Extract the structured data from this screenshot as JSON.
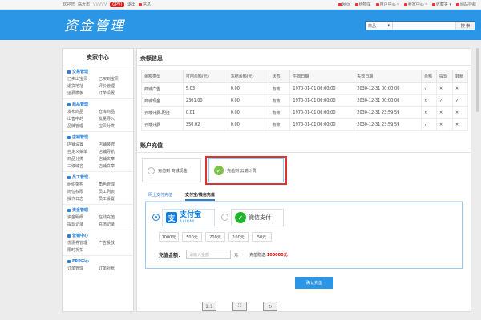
{
  "topbar": {
    "greeting": "欢迎您",
    "user": "临沂市",
    "stars": "VVVVV",
    "level": "GPVI",
    "logout": "退出",
    "messages": "信息",
    "links": [
      "网页",
      "购物车",
      "用户中心",
      "卖家中心",
      "收藏夹",
      "网站导航"
    ]
  },
  "header": {
    "logo": "资金管理",
    "search_category": "商品",
    "search_placeholder": "",
    "search_button": "搜 索"
  },
  "sidebar": {
    "title": "卖家中心",
    "sections": [
      {
        "heading": "交易管理",
        "items": [
          "已卖出宝贝",
          "已买到宝贝",
          "退货地址",
          "评价管理",
          "运费模板",
          "订单设置"
        ]
      },
      {
        "heading": "商品管理",
        "items": [
          "发布商品",
          "仓库商品",
          "出售中的",
          "批量导入",
          "品牌管理",
          "宝贝分类"
        ]
      },
      {
        "heading": "店铺管理",
        "items": [
          "店铺设置",
          "店铺装修",
          "自定义菜单",
          "店铺导航",
          "商品分类",
          "店铺文章",
          "二级域名",
          "店铺文章"
        ]
      },
      {
        "heading": "员工管理",
        "items": [
          "组织架构",
          "角色管理",
          "岗位权限",
          "员工列表",
          "操作日志",
          "员工设置"
        ]
      },
      {
        "heading": "资金管理",
        "items": [
          "资金明细",
          "在线充值",
          "提现记录",
          "充值记录"
        ]
      },
      {
        "heading": "营销中心",
        "items": [
          "优惠券管理",
          "广告投放",
          "限时折扣"
        ]
      },
      {
        "heading": "ERP中心",
        "items": [
          "订单管理",
          "订单对账"
        ]
      }
    ]
  },
  "balance": {
    "title": "余额信息",
    "columns": [
      "余额类型",
      "可用余额(元)",
      "冻结余额(元)",
      "状态",
      "生效日期",
      "失效日期",
      "余额",
      "提现",
      "转账"
    ],
    "rows": [
      {
        "type": "商城广告",
        "available": "5.03",
        "frozen": "0.00",
        "status": "有效",
        "start": "1970-01-01 00:00:00",
        "end": "2030-12-31 00:00:00",
        "c1": "✓",
        "c2": "✕",
        "c3": "✕"
      },
      {
        "type": "商城现金",
        "available": "2301.00",
        "frozen": "0.00",
        "status": "有效",
        "start": "1970-01-01 00:00:00",
        "end": "2030-12-31 00:00:00",
        "c1": "✕",
        "c2": "✓",
        "c3": "✓"
      },
      {
        "type": "云端计费-配送",
        "available": "0.01",
        "frozen": "0.00",
        "status": "有效",
        "start": "1970-01-01 00:00:00",
        "end": "2030-12-31 23:59:59",
        "c1": "✕",
        "c2": "✕",
        "c3": "✕"
      },
      {
        "type": "云端计费",
        "available": "350.02",
        "frozen": "0.00",
        "status": "有效",
        "start": "1970-01-01 00:00:00",
        "end": "2030-12-31 23:59:59",
        "c1": "✓",
        "c2": "✕",
        "c3": "✕"
      }
    ]
  },
  "recharge": {
    "title": "账户充值",
    "option1": "充值到 商城现金",
    "option2": "充值到 云端计费",
    "tab1": "网上支付充值",
    "tab2": "支付宝/微信充值",
    "alipay_name": "支付宝",
    "alipay_sub": "ALIPAY",
    "wechat_name": "微信支付",
    "amounts": [
      "1000元",
      "500元",
      "200元",
      "100元",
      "50元"
    ],
    "custom_label": "充值金额：",
    "custom_placeholder": "请输入金额",
    "custom_unit": "元",
    "gift_text": "充值赠送",
    "gift_value": "100000元",
    "confirm": "确认充值"
  },
  "viewer": {
    "ratio": "1:1"
  }
}
